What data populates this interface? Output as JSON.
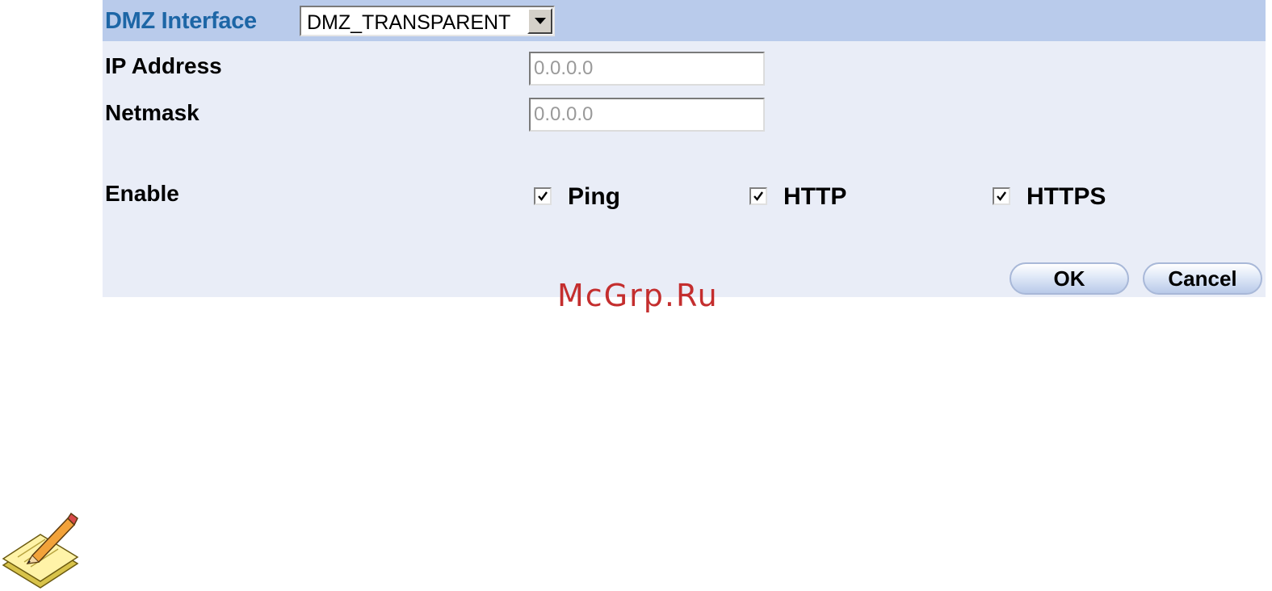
{
  "form": {
    "dmz_interface_label": "DMZ Interface",
    "dmz_interface_value": "DMZ_TRANSPARENT",
    "ip_address_label": "IP Address",
    "ip_address_value": "0.0.0.0",
    "netmask_label": "Netmask",
    "netmask_value": "0.0.0.0",
    "enable_label": "Enable",
    "options": [
      {
        "label": "Ping",
        "checked": true
      },
      {
        "label": "HTTP",
        "checked": true
      },
      {
        "label": "HTTPS",
        "checked": true
      }
    ]
  },
  "buttons": {
    "ok_label": "OK",
    "cancel_label": "Cancel"
  },
  "watermark": "McGrp.Ru",
  "icons": {
    "select_arrow": "chevron-down-icon",
    "checkbox_mark": "checkmark-icon",
    "note": "note-pencil-icon"
  },
  "colors": {
    "header_bar": "#b9cbeb",
    "panel_background": "#e9edf7",
    "label_accent": "#1d66a6",
    "watermark": "#c42e2e"
  }
}
